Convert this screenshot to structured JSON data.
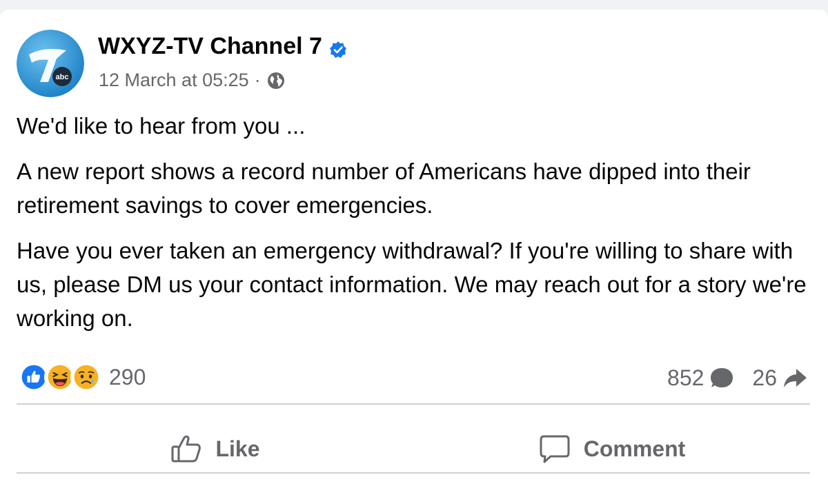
{
  "post": {
    "author": "WXYZ-TV Channel 7",
    "timestamp": "12 March at 05:25",
    "separator": "·",
    "visibility_icon": "globe-icon",
    "verified_icon": "verified-badge-icon",
    "avatar": {
      "number": "7",
      "network": "abc"
    },
    "paragraphs": [
      "We'd like to hear from you ...",
      "A new report shows a record number of Americans have dipped into their retirement savings to cover emergencies.",
      "Have you ever taken an emergency withdrawal? If you're willing to share with us, please DM us your contact information. We may reach out for a story we're working on."
    ]
  },
  "stats": {
    "reaction_icons": [
      "like-reaction-icon",
      "haha-reaction-icon",
      "sad-reaction-icon"
    ],
    "reaction_count": "290",
    "comment_count": "852",
    "share_count": "26"
  },
  "actions": {
    "like_label": "Like",
    "comment_label": "Comment"
  },
  "colors": {
    "verified": "#1877f2",
    "secondary_text": "#65676b",
    "like_blue": "#1877f2",
    "emoji_yellow": "#f7b125"
  }
}
